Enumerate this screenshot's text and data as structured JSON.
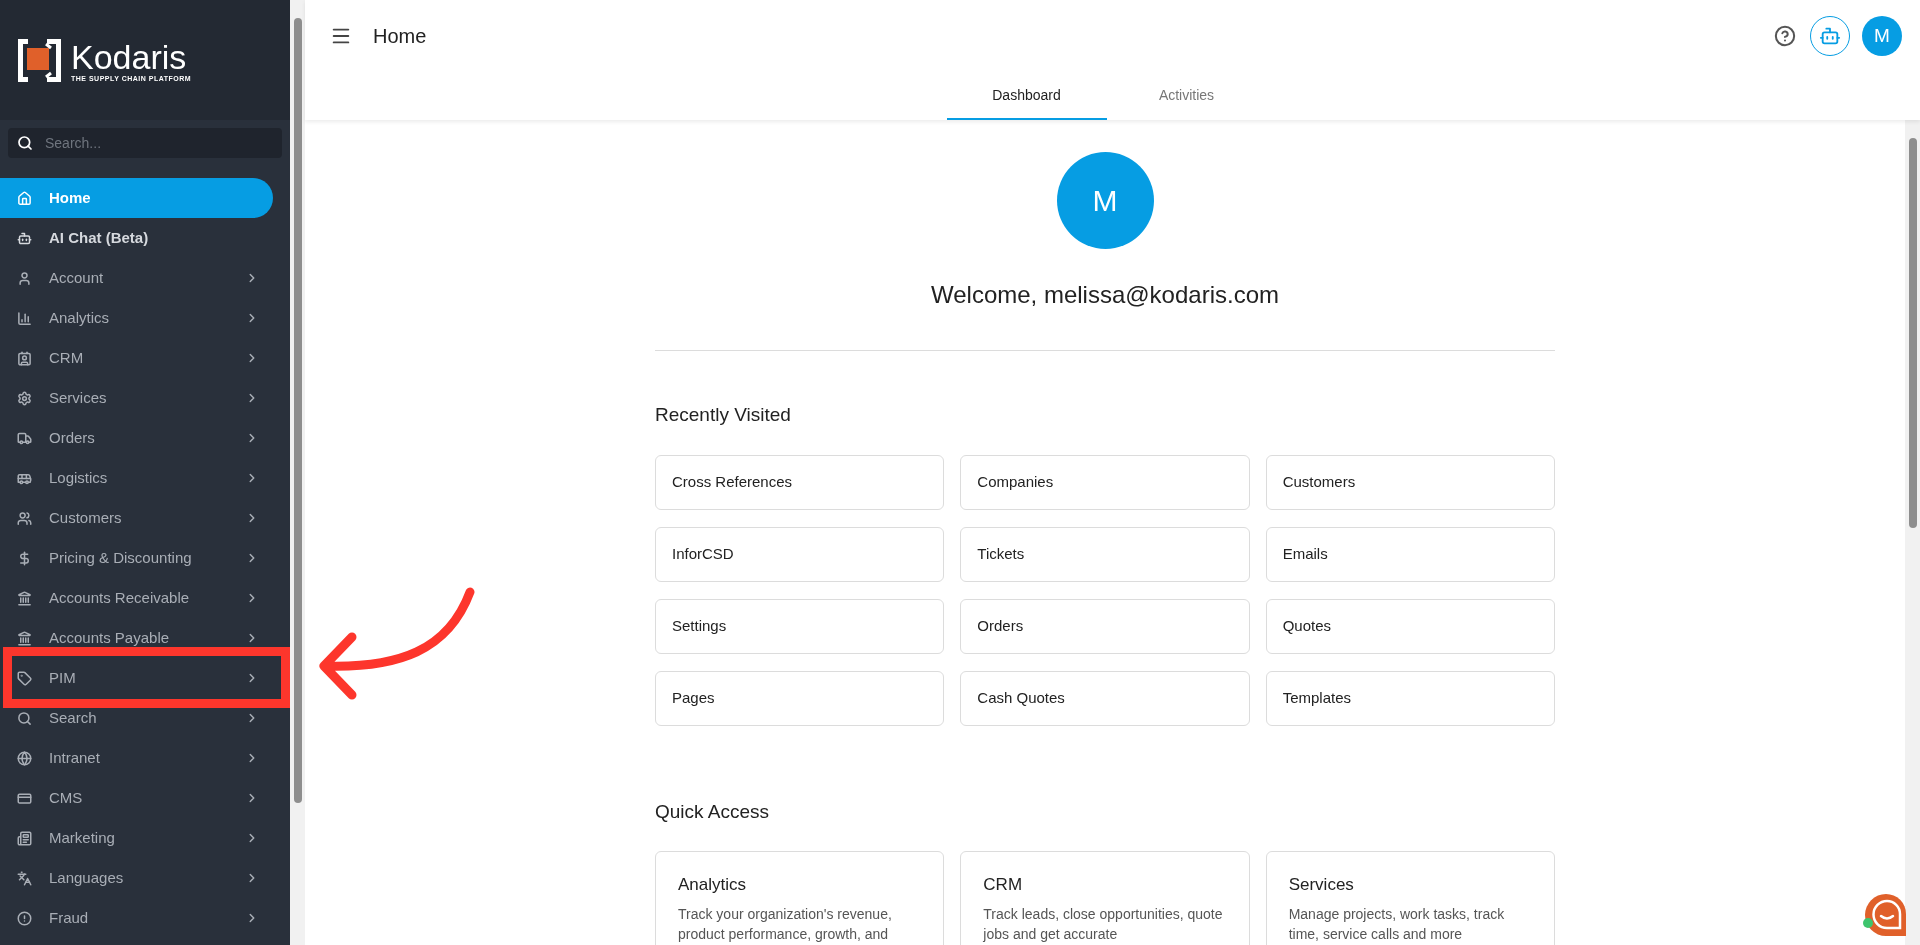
{
  "sidebar": {
    "logo": {
      "name": "Kodaris",
      "tagline": "THE SUPPLY CHAIN PLATFORM"
    },
    "search": {
      "placeholder": "Search..."
    },
    "items": [
      {
        "label": "Home",
        "selected": true,
        "expandable": false,
        "highlighted": false
      },
      {
        "label": "AI Chat (Beta)",
        "selected": false,
        "expandable": false,
        "highlighted": false
      },
      {
        "label": "Account",
        "selected": false,
        "expandable": true,
        "highlighted": false
      },
      {
        "label": "Analytics",
        "selected": false,
        "expandable": true,
        "highlighted": false
      },
      {
        "label": "CRM",
        "selected": false,
        "expandable": true,
        "highlighted": false
      },
      {
        "label": "Services",
        "selected": false,
        "expandable": true,
        "highlighted": false
      },
      {
        "label": "Orders",
        "selected": false,
        "expandable": true,
        "highlighted": false
      },
      {
        "label": "Logistics",
        "selected": false,
        "expandable": true,
        "highlighted": false
      },
      {
        "label": "Customers",
        "selected": false,
        "expandable": true,
        "highlighted": false
      },
      {
        "label": "Pricing & Discounting",
        "selected": false,
        "expandable": true,
        "highlighted": false
      },
      {
        "label": "Accounts Receivable",
        "selected": false,
        "expandable": true,
        "highlighted": false
      },
      {
        "label": "Accounts Payable",
        "selected": false,
        "expandable": true,
        "highlighted": false
      },
      {
        "label": "PIM",
        "selected": false,
        "expandable": true,
        "highlighted": true
      },
      {
        "label": "Search",
        "selected": false,
        "expandable": true,
        "highlighted": false
      },
      {
        "label": "Intranet",
        "selected": false,
        "expandable": true,
        "highlighted": false
      },
      {
        "label": "CMS",
        "selected": false,
        "expandable": true,
        "highlighted": false
      },
      {
        "label": "Marketing",
        "selected": false,
        "expandable": true,
        "highlighted": false
      },
      {
        "label": "Languages",
        "selected": false,
        "expandable": true,
        "highlighted": false
      },
      {
        "label": "Fraud",
        "selected": false,
        "expandable": true,
        "highlighted": false
      }
    ]
  },
  "header": {
    "title": "Home",
    "avatar": "M"
  },
  "tabs": [
    {
      "label": "Dashboard",
      "selected": true
    },
    {
      "label": "Activities",
      "selected": false
    }
  ],
  "profile": {
    "avatar": "M",
    "welcome": "Welcome, melissa@kodaris.com"
  },
  "recently_visited": {
    "title": "Recently Visited",
    "items": [
      "Cross References",
      "Companies",
      "Customers",
      "InforCSD",
      "Tickets",
      "Emails",
      "Settings",
      "Orders",
      "Quotes",
      "Pages",
      "Cash Quotes",
      "Templates"
    ]
  },
  "quick_access": {
    "title": "Quick Access",
    "cards": [
      {
        "title": "Analytics",
        "description": "Track your organization's revenue, product performance, growth, and"
      },
      {
        "title": "CRM",
        "description": "Track leads, close opportunities, quote jobs and get accurate"
      },
      {
        "title": "Services",
        "description": "Manage projects, work tasks, track time, service calls and more"
      }
    ]
  }
}
